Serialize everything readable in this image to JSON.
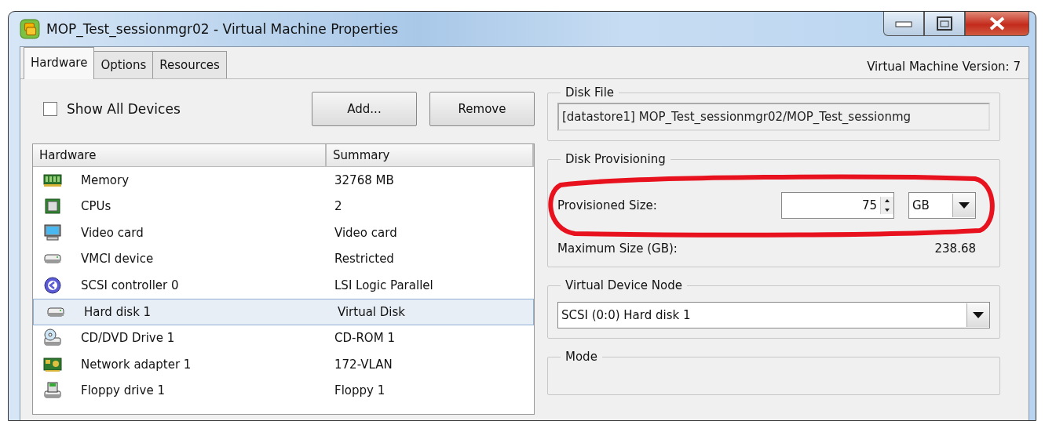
{
  "window": {
    "title": "MOP_Test_sessionmgr02 - Virtual Machine Properties"
  },
  "tabs": [
    {
      "label": "Hardware",
      "selected": true
    },
    {
      "label": "Options",
      "selected": false
    },
    {
      "label": "Resources",
      "selected": false
    }
  ],
  "version_label": "Virtual Machine Version: 7",
  "show_all_devices": {
    "label": "Show All Devices",
    "checked": false
  },
  "buttons": [
    "Add...",
    "Remove"
  ],
  "hardware_table": {
    "columns": [
      "Hardware",
      "Summary"
    ],
    "rows": [
      {
        "name": "Memory",
        "summary": "32768 MB",
        "selected": false
      },
      {
        "name": "CPUs",
        "summary": "2",
        "selected": false
      },
      {
        "name": "Video card",
        "summary": "Video card",
        "selected": false
      },
      {
        "name": "VMCI device",
        "summary": "Restricted",
        "selected": false
      },
      {
        "name": "SCSI controller 0",
        "summary": "LSI Logic Parallel",
        "selected": false
      },
      {
        "name": "Hard disk 1",
        "summary": "Virtual Disk",
        "selected": true
      },
      {
        "name": "CD/DVD Drive 1",
        "summary": "CD-ROM 1",
        "selected": false
      },
      {
        "name": "Network adapter 1",
        "summary": "172-VLAN",
        "selected": false
      },
      {
        "name": "Floppy drive 1",
        "summary": "Floppy 1",
        "selected": false
      }
    ]
  },
  "disk_file": {
    "legend": "Disk File",
    "value": "[datastore1] MOP_Test_sessionmgr02/MOP_Test_sessionmg"
  },
  "disk_provisioning": {
    "legend": "Disk Provisioning",
    "provisioned_label": "Provisioned Size:",
    "provisioned_value": "75",
    "unit": "GB",
    "max_label": "Maximum Size (GB):",
    "max_value": "238.68"
  },
  "annotation": {
    "kind": "ellipse"
  },
  "virtual_device_node": {
    "legend": "Virtual Device Node",
    "value": "SCSI (0:0) Hard disk 1"
  },
  "mode": {
    "legend": "Mode"
  }
}
